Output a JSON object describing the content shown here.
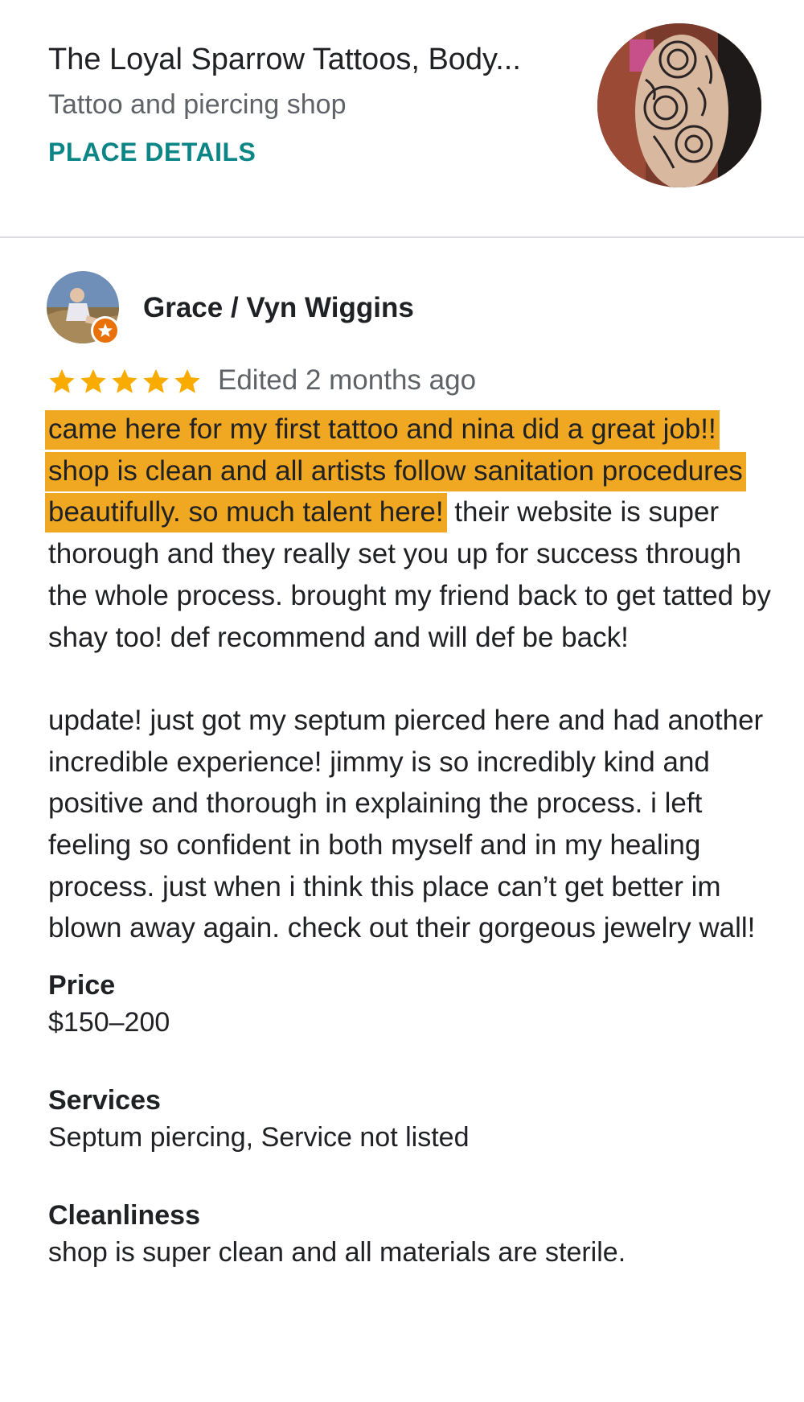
{
  "place": {
    "title": "The Loyal Sparrow Tattoos, Body...",
    "category": "Tattoo and piercing shop",
    "details_link": "PLACE DETAILS",
    "photo_icon": "tattoo-photo"
  },
  "review": {
    "reviewer_name": "Grace / Vyn Wiggins",
    "reviewer_badge_icon": "local-guide-star-badge",
    "rating": 5,
    "rating_max": 5,
    "star_color": "#f9ab00",
    "date": "Edited 2 months ago",
    "highlight_color": "#f0a823",
    "body_highlight": "came here for my first tattoo and nina did a great job!! shop is clean and all artists follow sanitation procedures beautifully. so much talent here!",
    "body_rest": " their website is super thorough and they really set you up for success through the whole process. brought my friend back to get tatted by shay too! def recommend and will def be back!",
    "update": "update! just got my septum pierced here and had another incredible experience! jimmy is so incredibly kind and positive and thorough in explaining the process. i left feeling so confident in both myself and in my healing process. just when i think this place can’t get better im blown away again. check out their gorgeous jewelry wall!"
  },
  "attributes": [
    {
      "label": "Price",
      "value": "$150–200"
    },
    {
      "label": "Services",
      "value": "Septum piercing, Service not listed"
    },
    {
      "label": "Cleanliness",
      "value": "shop is super clean and all materials are sterile."
    }
  ],
  "colors": {
    "link": "#0b8585",
    "secondary_text": "#5f6368",
    "divider": "#dadce0"
  }
}
